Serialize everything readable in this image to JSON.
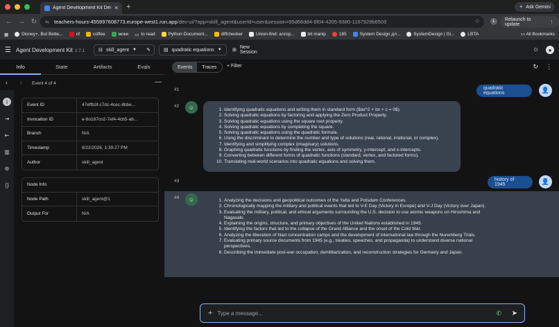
{
  "browser": {
    "tab_title": "Agent Development Kit Dev U",
    "ask_gemini": "Ask Gemini",
    "url_host": "teachers-hours-455997608773.europe-west1.run.app",
    "url_path": "/dev-ui/?app=skill_agent&userId=user&session=95d66dd4-8f04-4205-9380-1167929b6503",
    "profile_initial": "L",
    "relaunch": "Relaunch to update",
    "bookmarks": [
      "Disney+, But Bette...",
      "nf",
      "coffee",
      "моки",
      "to read",
      "Python Document...",
      "diffchecker",
      "Union-find: алгор...",
      "bit manip",
      "185",
      "System Design дл...",
      "SystemDesign | Gi...",
      "LBTA"
    ],
    "all_bookmarks": "All Bookmarks"
  },
  "app": {
    "title": "Agent Development Kit",
    "version": "2.7.1",
    "agent": "skill_agent",
    "session_name": "quadratic equations",
    "new_session": "New Session"
  },
  "panel": {
    "tabs": [
      "Info",
      "State",
      "Artifacts",
      "Evals"
    ],
    "event_nav": "Event 4 of 4",
    "info_rows": [
      {
        "k": "Event ID",
        "v": "47effb3f-c7dc-4cec-8bbe..."
      },
      {
        "k": "Invocation ID",
        "v": "e-8o187co2-7ef4-4cb5-ab..."
      },
      {
        "k": "Branch",
        "v": "N/A"
      },
      {
        "k": "Timestamp",
        "v": "8/22/2026, 1:39:27 PM"
      },
      {
        "k": "Author",
        "v": "skill_agent"
      }
    ],
    "node_header": "Node Info",
    "node_rows": [
      {
        "k": "Node Path",
        "v": "skill_agent@1"
      },
      {
        "k": "Output For",
        "v": "N/A"
      }
    ]
  },
  "main": {
    "seg_events": "Events",
    "seg_traces": "Traces",
    "filter": "Filter",
    "n1": "#1",
    "n2": "#2",
    "n3": "#3",
    "n4": "#4",
    "msg1": "quadratic equations",
    "msg3": "history of 1945",
    "resp2": [
      "Identifying quadratic equations and writing them in standard form ($ax^2 + bx + c = 0$).",
      "Solving quadratic equations by factoring and applying the Zero Product Property.",
      "Solving quadratic equations using the square root property.",
      "Solving quadratic equations by completing the square.",
      "Solving quadratic equations using the quadratic formula.",
      "Using the discriminant to determine the number and type of solutions (real, rational, irrational, or complex).",
      "Identifying and simplifying complex (imaginary) solutions.",
      "Graphing quadratic functions by finding the vertex, axis of symmetry, y-intercept, and x-intercepts.",
      "Converting between different forms of quadratic functions (standard, vertex, and factored forms).",
      "Translating real-world scenarios into quadratic equations and solving them."
    ],
    "resp4": [
      "Analyzing the decisions and geopolitical outcomes of the Yalta and Potsdam Conferences.",
      "Chronologically mapping the military and political events that led to V-E Day (Victory in Europe) and V-J Day (Victory over Japan).",
      "Evaluating the military, political, and ethical arguments surrounding the U.S. decision to use atomic weapons on Hiroshima and Nagasaki.",
      "Explaining the origins, structure, and primary objectives of the United Nations established in 1945.",
      "Identifying the factors that led to the collapse of the Grand Alliance and the onset of the Cold War.",
      "Analyzing the liberation of Nazi concentration camps and the development of international law through the Nuremberg Trials.",
      "Evaluating primary source documents from 1945 (e.g., treaties, speeches, and propaganda) to understand diverse national perspectives.",
      "Describing the immediate post-war occupation, demilitarization, and reconstruction strategies for Germany and Japan."
    ],
    "composer_placeholder": "Type a message..."
  }
}
